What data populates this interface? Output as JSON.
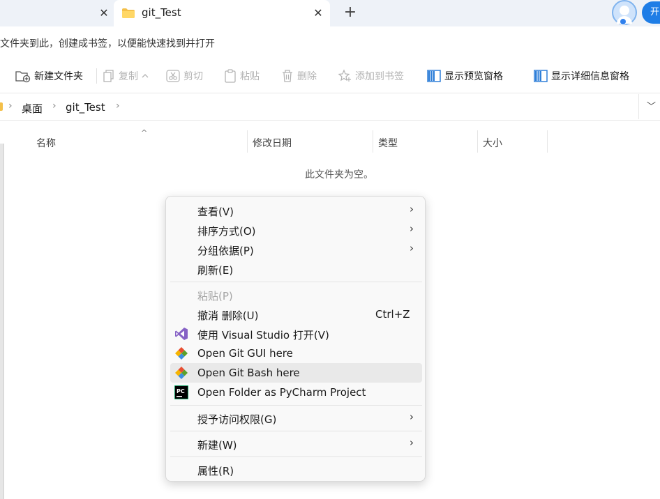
{
  "tabs": {
    "previous_close": "✕",
    "active_title": "git_Test",
    "active_close": "✕",
    "new_tab": "+",
    "open_button": "开"
  },
  "infobar": {
    "text": "文件夹到此，创建成书签，以便能快速找到并打开"
  },
  "toolbar": {
    "new_folder": "新建文件夹",
    "copy": "复制",
    "cut": "剪切",
    "paste": "粘贴",
    "delete": "删除",
    "add_bookmark": "添加到书签",
    "preview_pane": "显示预览窗格",
    "details_pane": "显示详细信息窗格"
  },
  "address": {
    "crumbs": [
      "桌面",
      "git_Test"
    ]
  },
  "columns": {
    "name": "名称",
    "modified": "修改日期",
    "type": "类型",
    "size": "大小"
  },
  "empty_message": "此文件夹为空。",
  "context_menu": {
    "view": "查看(V)",
    "sort_by": "排序方式(O)",
    "group_by": "分组依据(P)",
    "refresh": "刷新(E)",
    "paste": "粘贴(P)",
    "undo_delete": "撤消 删除(U)",
    "undo_shortcut": "Ctrl+Z",
    "open_with_vs": "使用 Visual Studio 打开(V)",
    "git_gui": "Open Git GUI here",
    "git_bash": "Open Git Bash here",
    "pycharm": "Open Folder as PyCharm Project",
    "grant_access": "授予访问权限(G)",
    "new": "新建(W)",
    "properties": "属性(R)"
  },
  "colors": {
    "accent": "#1e7de6",
    "folder": "#f4c04a",
    "menu_hover": "#e9e9e9",
    "vs_purple": "#8661c5"
  }
}
